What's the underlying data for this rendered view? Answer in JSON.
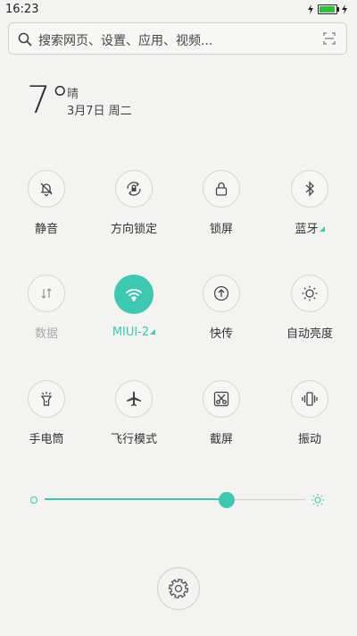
{
  "status_bar": {
    "time": "16:23",
    "battery_level": 0.95,
    "battery_color": "#2fbf3a"
  },
  "search": {
    "placeholder": "搜索网页、设置、应用、视频..."
  },
  "weather": {
    "temperature": "7°",
    "condition": "晴",
    "date": "3月7日 周二"
  },
  "toggles": [
    {
      "label": "静音",
      "icon": "bell-off-icon",
      "active": false
    },
    {
      "label": "方向锁定",
      "icon": "rotation-lock-icon",
      "active": false
    },
    {
      "label": "锁屏",
      "icon": "lock-icon",
      "active": false
    },
    {
      "label": "蓝牙",
      "icon": "bluetooth-icon",
      "active": false,
      "has_submenu": true
    },
    {
      "label": "数据",
      "icon": "mobile-data-icon",
      "active": false,
      "disabled": true
    },
    {
      "label": "MIUI-2",
      "icon": "wifi-icon",
      "active": true,
      "has_submenu": true
    },
    {
      "label": "快传",
      "icon": "quick-transfer-icon",
      "active": false
    },
    {
      "label": "自动亮度",
      "icon": "auto-brightness-icon",
      "active": false
    },
    {
      "label": "手电筒",
      "icon": "flashlight-icon",
      "active": false
    },
    {
      "label": "飞行模式",
      "icon": "airplane-icon",
      "active": false
    },
    {
      "label": "截屏",
      "icon": "screenshot-icon",
      "active": false
    },
    {
      "label": "振动",
      "icon": "vibrate-icon",
      "active": false
    }
  ],
  "brightness": {
    "level": 0.7
  },
  "colors": {
    "accent": "#3ec7b1",
    "background": "#f3f3f1"
  }
}
